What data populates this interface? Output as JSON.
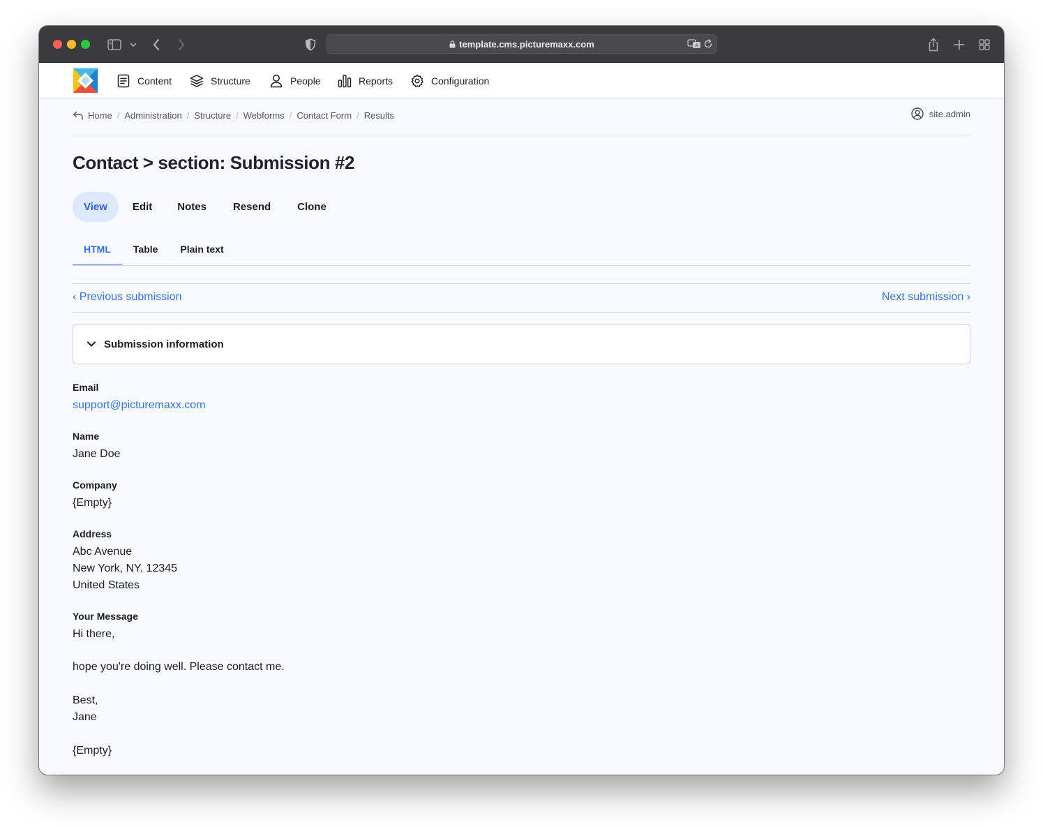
{
  "browser": {
    "url": "template.cms.picturemaxx.com"
  },
  "nav": {
    "items": [
      {
        "label": "Content",
        "icon": "document-icon"
      },
      {
        "label": "Structure",
        "icon": "layers-icon"
      },
      {
        "label": "People",
        "icon": "person-icon"
      },
      {
        "label": "Reports",
        "icon": "bar-chart-icon"
      },
      {
        "label": "Configuration",
        "icon": "gear-icon"
      }
    ]
  },
  "breadcrumb": {
    "items": [
      "Home",
      "Administration",
      "Structure",
      "Webforms",
      "Contact Form",
      "Results"
    ]
  },
  "user": {
    "name": "site.admin"
  },
  "page": {
    "title": "Contact > section: Submission #2"
  },
  "primary_tabs": [
    "View",
    "Edit",
    "Notes",
    "Resend",
    "Clone"
  ],
  "secondary_tabs": [
    "HTML",
    "Table",
    "Plain text"
  ],
  "pager": {
    "previous": "‹ Previous submission",
    "next": "Next submission ›"
  },
  "details": {
    "label": "Submission information"
  },
  "fields": {
    "email": {
      "label": "Email",
      "value": "support@picturemaxx.com"
    },
    "name": {
      "label": "Name",
      "value": "Jane Doe"
    },
    "company": {
      "label": "Company",
      "value": "{Empty}"
    },
    "address": {
      "label": "Address",
      "line1": "Abc Avenue",
      "line2": "New York, NY. 12345",
      "line3": "United States"
    },
    "message": {
      "label": "Your Message",
      "line1": "Hi there,",
      "line2": "hope you're doing well. Please contact me.",
      "line3": "Best,",
      "line4": "Jane"
    },
    "trailing": {
      "value": "{Empty}"
    }
  },
  "colors": {
    "accent": "#3b73d8",
    "active_tab_bg": "#dde8fb",
    "page_bg": "#f6f9fd"
  }
}
